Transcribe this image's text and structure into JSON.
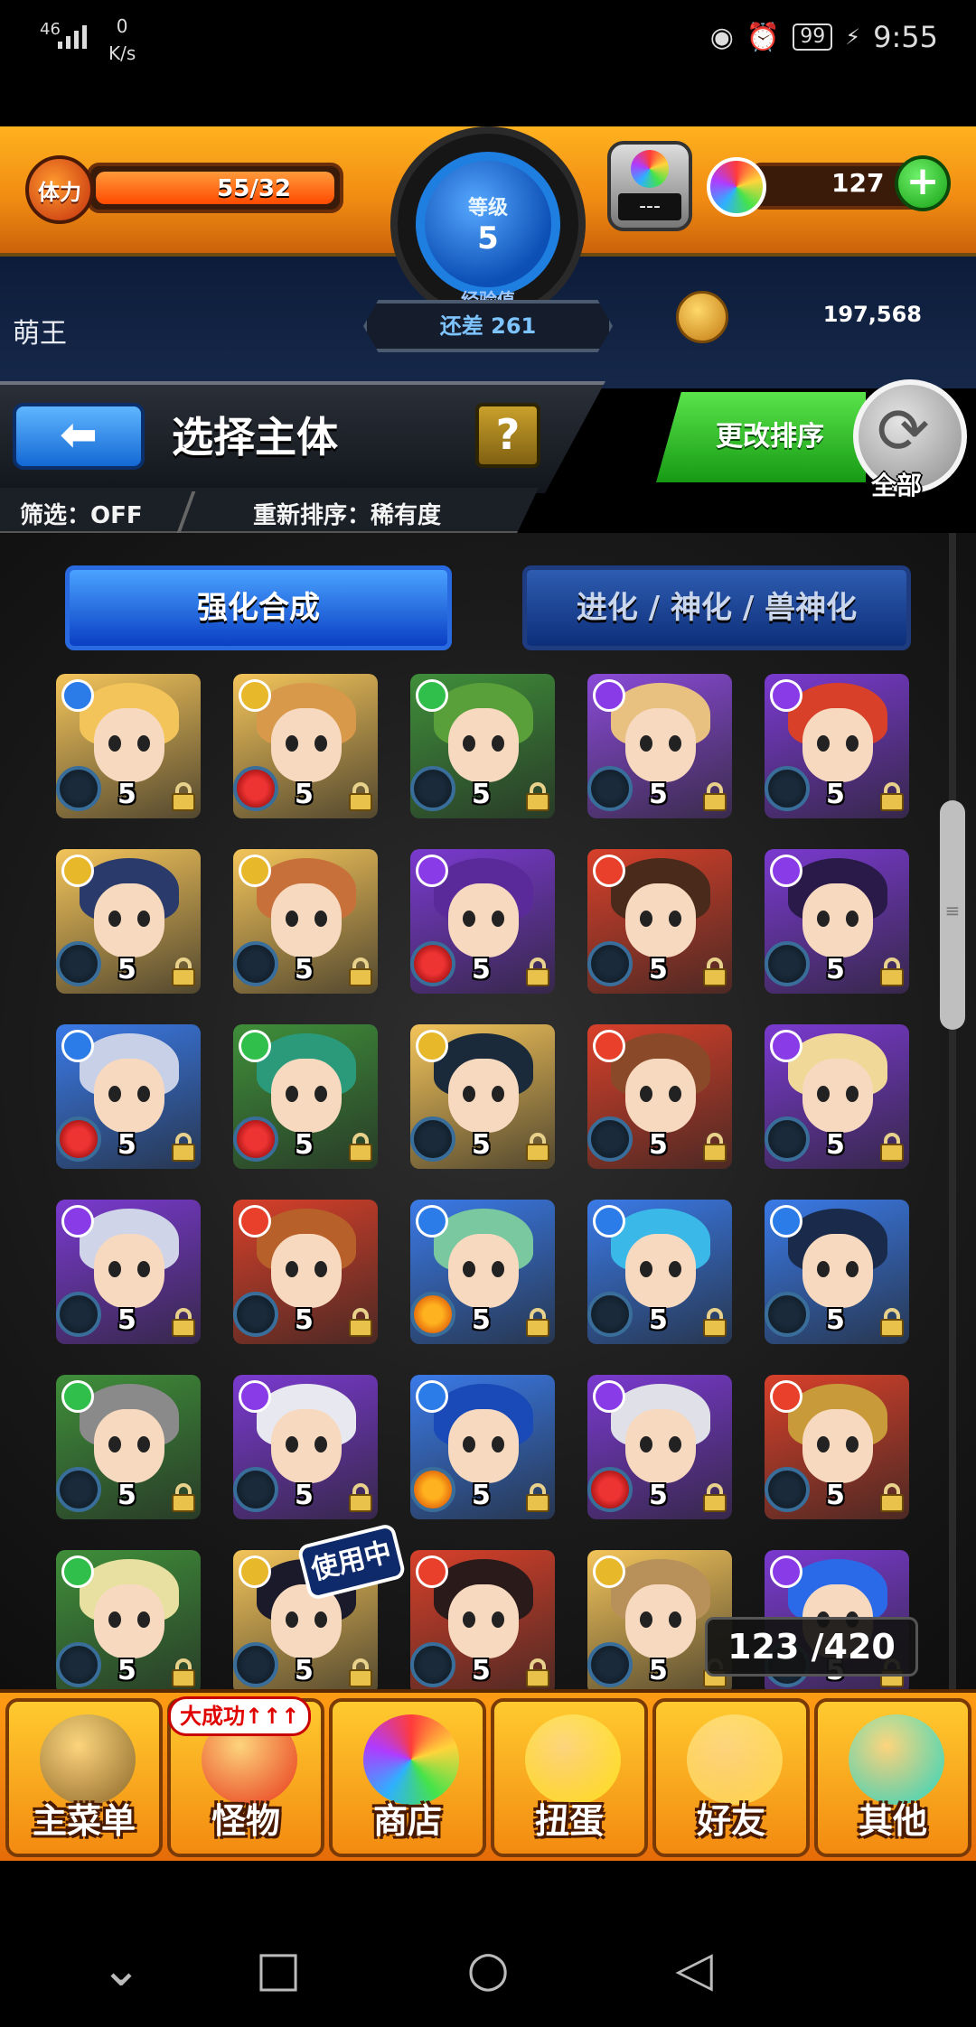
{
  "status_bar": {
    "signal": "46",
    "speed_value": "0",
    "speed_unit": "K/s",
    "battery": "99",
    "time": "9:55"
  },
  "header": {
    "stamina_label": "体力",
    "stamina_value": "55/32",
    "level_label": "等级",
    "level_value": "5",
    "exp_label": "经验值",
    "exp_value": "还差 261",
    "orb_value": "---",
    "gem_count": "127",
    "player_name": "萌王",
    "coins": "197,568"
  },
  "title_bar": {
    "title": "选择主体",
    "help": "?",
    "filter": "筛选：OFF",
    "sort": "重新排序：稀有度",
    "change_sort": "更改排序",
    "refresh_label": "全部"
  },
  "tabs": {
    "active": "强化合成",
    "inactive": "进化 / 神化 / 兽神化"
  },
  "colors": {
    "wood": "#2fbf4a",
    "water": "#2b7be8",
    "fire": "#e8402b",
    "light": "#e8b82b",
    "dark": "#8a3be8"
  },
  "monsters": [
    {
      "element": "water",
      "ability": "normal",
      "rarity": "5",
      "hair": "#f3c45a",
      "bg": "#f3c45a"
    },
    {
      "element": "light",
      "ability": "fruit",
      "rarity": "5",
      "hair": "#d89a4a",
      "bg": "#f3c45a"
    },
    {
      "element": "wood",
      "ability": "normal",
      "rarity": "5",
      "hair": "#5aa03a",
      "bg": "#3f8f3a"
    },
    {
      "element": "dark",
      "ability": "normal",
      "rarity": "5",
      "hair": "#e8c080",
      "bg": "#8a4ad8"
    },
    {
      "element": "dark",
      "ability": "normal",
      "rarity": "5",
      "hair": "#d8402a",
      "bg": "#7a3ad0"
    },
    {
      "element": "light",
      "ability": "normal",
      "rarity": "5",
      "hair": "#2a3a6a",
      "bg": "#f3c45a"
    },
    {
      "element": "light",
      "ability": "normal",
      "rarity": "5",
      "hair": "#c8703a",
      "bg": "#f3c45a"
    },
    {
      "element": "dark",
      "ability": "fruit",
      "rarity": "5",
      "hair": "#5a2a9a",
      "bg": "#7a3ad0"
    },
    {
      "element": "fire",
      "ability": "normal",
      "rarity": "5",
      "hair": "#4a2a1a",
      "bg": "#d8402a"
    },
    {
      "element": "dark",
      "ability": "normal",
      "rarity": "5",
      "hair": "#2a1a4a",
      "bg": "#7a3ad0"
    },
    {
      "element": "water",
      "ability": "fruit",
      "rarity": "5",
      "hair": "#c8d0e8",
      "bg": "#3a7ae8"
    },
    {
      "element": "wood",
      "ability": "fruit",
      "rarity": "5",
      "hair": "#2a9a7a",
      "bg": "#3f8f3a"
    },
    {
      "element": "light",
      "ability": "normal",
      "rarity": "5",
      "hair": "#1a2a3a",
      "bg": "#f3c45a"
    },
    {
      "element": "fire",
      "ability": "normal",
      "rarity": "5",
      "hair": "#8a4a2a",
      "bg": "#d8402a"
    },
    {
      "element": "dark",
      "ability": "normal",
      "rarity": "5",
      "hair": "#f0d898",
      "bg": "#7a3ad0"
    },
    {
      "element": "dark",
      "ability": "normal",
      "rarity": "5",
      "hair": "#d0d4e8",
      "bg": "#7a3ad0"
    },
    {
      "element": "fire",
      "ability": "normal",
      "rarity": "5",
      "hair": "#b8602a",
      "bg": "#d8402a"
    },
    {
      "element": "water",
      "ability": "fire",
      "rarity": "5",
      "hair": "#7ac8a0",
      "bg": "#3a7ae8"
    },
    {
      "element": "water",
      "ability": "normal",
      "rarity": "5",
      "hair": "#3ab8e8",
      "bg": "#3a7ae8"
    },
    {
      "element": "water",
      "ability": "normal",
      "rarity": "5",
      "hair": "#1a2a4a",
      "bg": "#3a7ae8"
    },
    {
      "element": "wood",
      "ability": "normal",
      "rarity": "5",
      "hair": "#8a8a8a",
      "bg": "#3f8f3a"
    },
    {
      "element": "dark",
      "ability": "normal",
      "rarity": "5",
      "hair": "#e8e8f0",
      "bg": "#7a3ad0"
    },
    {
      "element": "water",
      "ability": "fire",
      "rarity": "5",
      "hair": "#1a4ab8",
      "bg": "#3a7ae8"
    },
    {
      "element": "dark",
      "ability": "fruit",
      "rarity": "5",
      "hair": "#e0e0e8",
      "bg": "#7a3ad0"
    },
    {
      "element": "fire",
      "ability": "normal",
      "rarity": "5",
      "hair": "#c89a3a",
      "bg": "#d8402a"
    },
    {
      "element": "wood",
      "ability": "normal",
      "rarity": "5",
      "hair": "#e8e0a0",
      "bg": "#3f8f3a"
    },
    {
      "element": "light",
      "ability": "normal",
      "rarity": "5",
      "hair": "#1a1a2a",
      "bg": "#f3c45a"
    },
    {
      "element": "fire",
      "ability": "normal",
      "rarity": "5",
      "hair": "#2a1a1a",
      "bg": "#d8402a"
    },
    {
      "element": "light",
      "ability": "normal",
      "rarity": "5",
      "hair": "#b8905a",
      "bg": "#f3c45a"
    },
    {
      "element": "dark",
      "ability": "normal",
      "rarity": "5",
      "hair": "#2a6ae8",
      "bg": "#7a3ad0"
    }
  ],
  "in_use_label": "使用中",
  "box_count": "123 /420",
  "bottom_nav": [
    {
      "label": "主菜单",
      "icon": "castle-icon",
      "color": "#8a6a2a"
    },
    {
      "label": "怪物",
      "icon": "monster-icon",
      "color": "#e83a1a"
    },
    {
      "label": "商店",
      "icon": "shop-orb-icon",
      "color": "rainbow"
    },
    {
      "label": "扭蛋",
      "icon": "gacha-egg-icon",
      "color": "#ffe01a"
    },
    {
      "label": "好友",
      "icon": "friends-icon",
      "color": "#ffd84a"
    },
    {
      "label": "其他",
      "icon": "other-icon",
      "color": "#2ad8c0"
    }
  ],
  "monster_badge": "大成功↑↑↑"
}
